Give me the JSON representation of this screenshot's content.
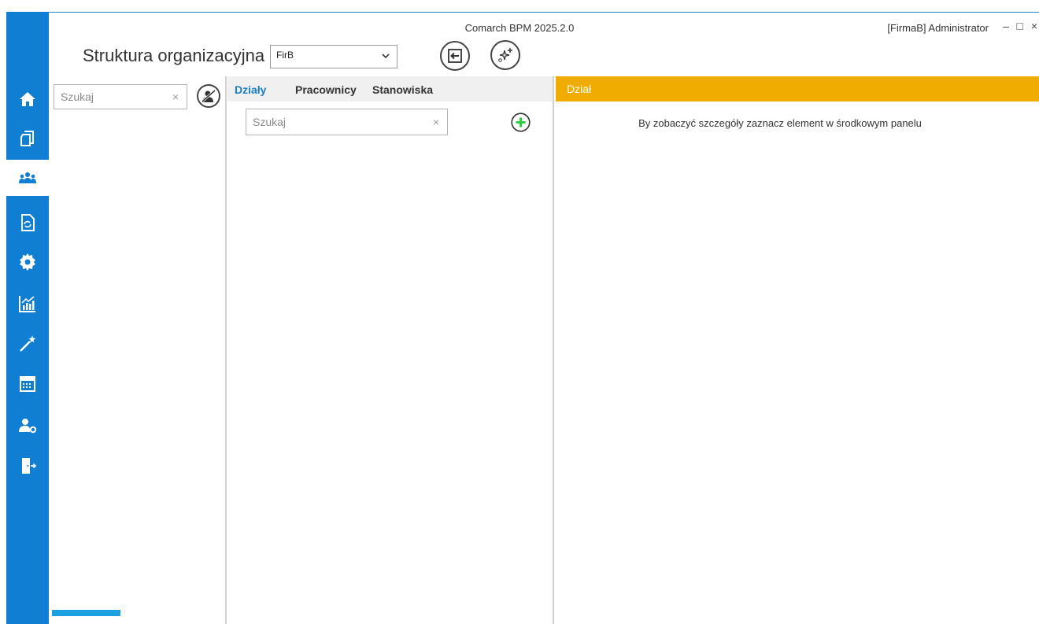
{
  "app": {
    "title": "Comarch BPM 2025.2.0",
    "user": "[FirmaB]  Administrator"
  },
  "window_controls": {
    "minimize": "–",
    "maximize": "□",
    "close": "×"
  },
  "header": {
    "page_title": "Struktura organizacyjna",
    "company_selected": "FirB"
  },
  "left_panel": {
    "search_placeholder": "Szukaj",
    "clear": "×"
  },
  "middle_panel": {
    "tabs": [
      {
        "label": "Działy",
        "active": true
      },
      {
        "label": "Pracownicy",
        "active": false
      },
      {
        "label": "Stanowiska",
        "active": false
      }
    ],
    "search_placeholder": "Szukaj",
    "clear": "×"
  },
  "right_panel": {
    "header": "Dział",
    "hint": "By zobaczyć szczegóły zaznacz element w środkowym panelu"
  },
  "sidebar": {
    "items": [
      {
        "icon": "home-icon",
        "active": false
      },
      {
        "icon": "documents-icon",
        "active": false
      },
      {
        "icon": "users-icon",
        "active": true
      },
      {
        "icon": "document-refresh-icon",
        "active": false
      },
      {
        "icon": "gear-icon",
        "active": false
      },
      {
        "icon": "chart-icon",
        "active": false
      },
      {
        "icon": "magic-wand-icon",
        "active": false
      },
      {
        "icon": "calendar-icon",
        "active": false
      },
      {
        "icon": "user-settings-icon",
        "active": false
      },
      {
        "icon": "exit-door-icon",
        "active": false
      }
    ]
  },
  "colors": {
    "sidebar": "#0f7ed3",
    "accent_blue": "#1a7fc1",
    "detail_header": "#f0ac00",
    "add_button": "#2ecc40"
  }
}
